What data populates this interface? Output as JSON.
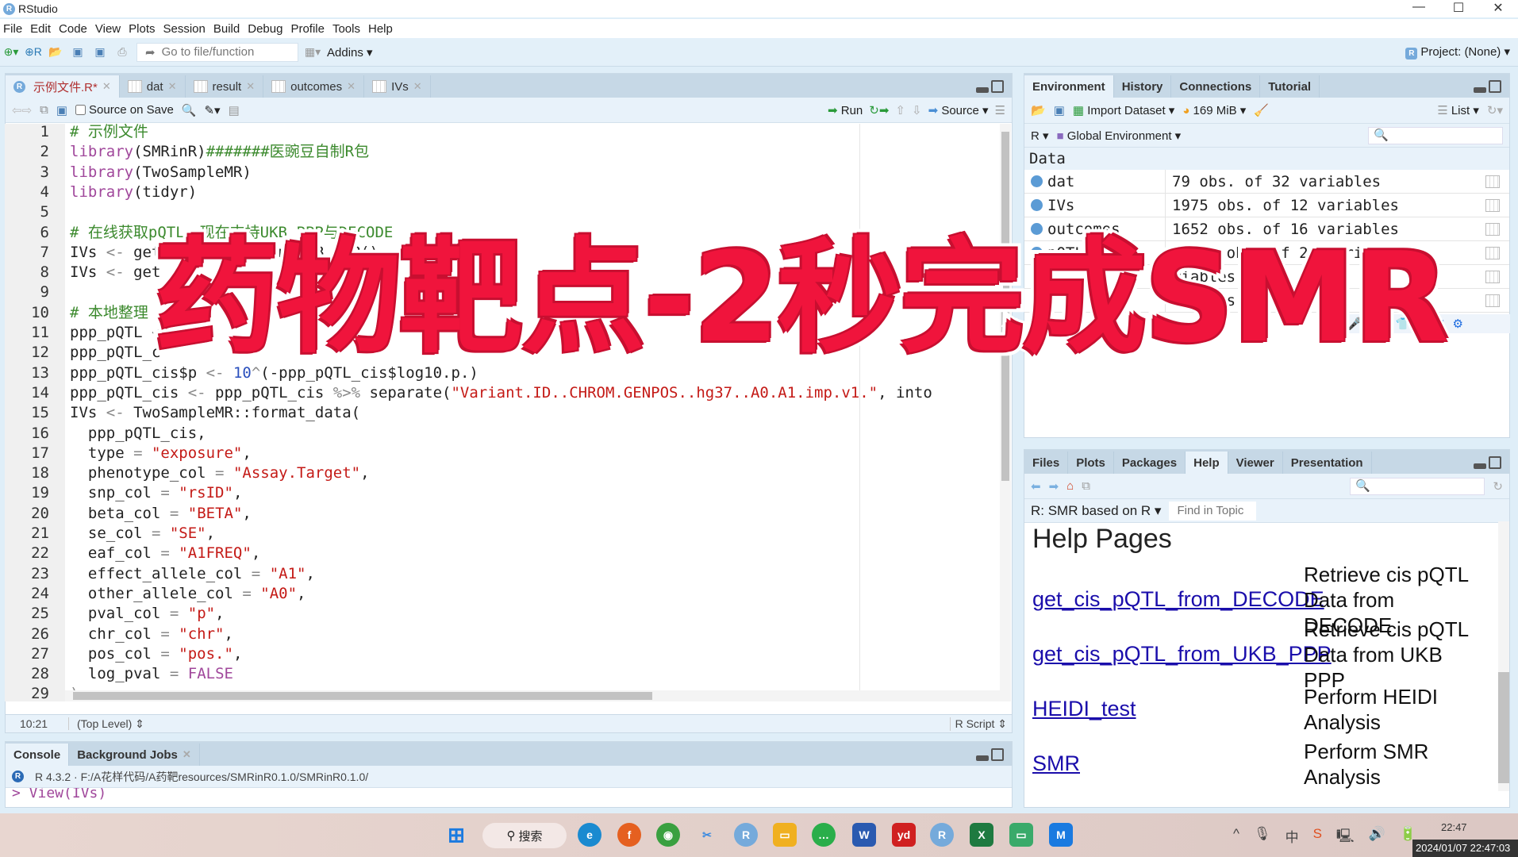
{
  "window": {
    "title": "RStudio"
  },
  "menu": [
    "File",
    "Edit",
    "Code",
    "View",
    "Plots",
    "Session",
    "Build",
    "Debug",
    "Profile",
    "Tools",
    "Help"
  ],
  "toolbar": {
    "goto_placeholder": "Go to file/function",
    "addins": "Addins",
    "project": "Project: (None)"
  },
  "editor": {
    "tabs": [
      {
        "label": "示例文件.R*",
        "active": true
      },
      {
        "label": "dat"
      },
      {
        "label": "result"
      },
      {
        "label": "outcomes"
      },
      {
        "label": "IVs"
      }
    ],
    "source_on_save": "Source on Save",
    "run": "Run",
    "source": "Source",
    "lines": [
      [
        [
          "# 示例文件",
          "c"
        ]
      ],
      [
        [
          "library",
          "k"
        ],
        [
          "(SMRinR)",
          ""
        ],
        [
          "#######医豌豆自制R包",
          "c"
        ]
      ],
      [
        [
          "library",
          "k"
        ],
        [
          "(TwoSampleMR)",
          ""
        ]
      ],
      [
        [
          "library",
          "k"
        ],
        [
          "(tidyr)",
          ""
        ]
      ],
      [],
      [
        [
          "# 在线获取pQTL，现在支持UKB_PPP与DECODE",
          "c"
        ]
      ],
      [
        [
          "IVs ",
          ""
        ],
        [
          "<-",
          "o"
        ],
        [
          " get_cis_pQTL_from_UKB_PPP()",
          ""
        ]
      ],
      [
        [
          "IVs ",
          ""
        ],
        [
          "<-",
          "o"
        ],
        [
          " get",
          ""
        ]
      ],
      [],
      [
        [
          "# 本地整理",
          "c"
        ]
      ],
      [
        [
          "ppp_pQTL ",
          ""
        ],
        [
          "<",
          "o"
        ]
      ],
      [
        [
          "ppp_pQTL_c",
          ""
        ]
      ],
      [
        [
          "ppp_pQTL_cis$p ",
          ""
        ],
        [
          "<-",
          "o"
        ],
        [
          " ",
          ""
        ],
        [
          "10",
          "n"
        ],
        [
          "^",
          "o"
        ],
        [
          "(-ppp_pQTL_cis$log10.p.)",
          ""
        ]
      ],
      [
        [
          "ppp_pQTL_cis ",
          ""
        ],
        [
          "<-",
          "o"
        ],
        [
          " ppp_pQTL_cis ",
          ""
        ],
        [
          "%>%",
          "o"
        ],
        [
          " separate(",
          ""
        ],
        [
          "\"Variant.ID..CHROM.GENPOS..hg37..A0.A1.imp.v1.\"",
          "s"
        ],
        [
          ", into",
          ""
        ]
      ],
      [
        [
          "IVs ",
          ""
        ],
        [
          "<-",
          "o"
        ],
        [
          " TwoSampleMR::format_data(",
          ""
        ]
      ],
      [
        [
          "  ppp_pQTL_cis,",
          ""
        ]
      ],
      [
        [
          "  type ",
          ""
        ],
        [
          "=",
          "o"
        ],
        [
          " ",
          ""
        ],
        [
          "\"exposure\"",
          "s"
        ],
        [
          ",",
          ""
        ]
      ],
      [
        [
          "  phenotype_col ",
          ""
        ],
        [
          "=",
          "o"
        ],
        [
          " ",
          ""
        ],
        [
          "\"Assay.Target\"",
          "s"
        ],
        [
          ",",
          ""
        ]
      ],
      [
        [
          "  snp_col ",
          ""
        ],
        [
          "=",
          "o"
        ],
        [
          " ",
          ""
        ],
        [
          "\"rsID\"",
          "s"
        ],
        [
          ",",
          ""
        ]
      ],
      [
        [
          "  beta_col ",
          ""
        ],
        [
          "=",
          "o"
        ],
        [
          " ",
          ""
        ],
        [
          "\"BETA\"",
          "s"
        ],
        [
          ",",
          ""
        ]
      ],
      [
        [
          "  se_col ",
          ""
        ],
        [
          "=",
          "o"
        ],
        [
          " ",
          ""
        ],
        [
          "\"SE\"",
          "s"
        ],
        [
          ",",
          ""
        ]
      ],
      [
        [
          "  eaf_col ",
          ""
        ],
        [
          "=",
          "o"
        ],
        [
          " ",
          ""
        ],
        [
          "\"A1FREQ\"",
          "s"
        ],
        [
          ",",
          ""
        ]
      ],
      [
        [
          "  effect_allele_col ",
          ""
        ],
        [
          "=",
          "o"
        ],
        [
          " ",
          ""
        ],
        [
          "\"A1\"",
          "s"
        ],
        [
          ",",
          ""
        ]
      ],
      [
        [
          "  other_allele_col ",
          ""
        ],
        [
          "=",
          "o"
        ],
        [
          " ",
          ""
        ],
        [
          "\"A0\"",
          "s"
        ],
        [
          ",",
          ""
        ]
      ],
      [
        [
          "  pval_col ",
          ""
        ],
        [
          "=",
          "o"
        ],
        [
          " ",
          ""
        ],
        [
          "\"p\"",
          "s"
        ],
        [
          ",",
          ""
        ]
      ],
      [
        [
          "  chr_col ",
          ""
        ],
        [
          "=",
          "o"
        ],
        [
          " ",
          ""
        ],
        [
          "\"chr\"",
          "s"
        ],
        [
          ",",
          ""
        ]
      ],
      [
        [
          "  pos_col ",
          ""
        ],
        [
          "=",
          "o"
        ],
        [
          " ",
          ""
        ],
        [
          "\"pos.\"",
          "s"
        ],
        [
          ",",
          ""
        ]
      ],
      [
        [
          "  log_pval ",
          ""
        ],
        [
          "=",
          "o"
        ],
        [
          " ",
          ""
        ],
        [
          "FALSE",
          "b"
        ]
      ],
      [
        [
          ")",
          "o"
        ]
      ],
      []
    ],
    "status": {
      "cursor": "10:21",
      "scope": "(Top Level)",
      "filetype": "R Script"
    }
  },
  "overlay_title": "药物靶点-2秒完成SMR",
  "console": {
    "tabs": [
      "Console",
      "Background Jobs"
    ],
    "path": "R 4.3.2 · F:/A花样代码/A药靶resources/SMRinR0.1.0/SMRinR0.1.0/",
    "last_line": "> View(IVs)"
  },
  "environment": {
    "tabs": [
      "Environment",
      "History",
      "Connections",
      "Tutorial"
    ],
    "import": "Import Dataset",
    "memory": "169 MiB",
    "view": "List",
    "lang": "R",
    "scope": "Global Environment",
    "section": "Data",
    "rows": [
      {
        "name": "dat",
        "value": "79 obs. of 32 variables"
      },
      {
        "name": "IVs",
        "value": "1975 obs. of 12 variables"
      },
      {
        "name": "outcomes",
        "value": "1652 obs. of 16 variables"
      },
      {
        "name": "pQTL",
        "value": "23588 obs. of 29 variables"
      },
      {
        "name": "",
        "value": "riables"
      },
      {
        "name": "",
        "value": "riables"
      }
    ]
  },
  "help": {
    "tabs": [
      "Files",
      "Plots",
      "Packages",
      "Help",
      "Viewer",
      "Presentation"
    ],
    "topic": "R: SMR based on R",
    "find_placeholder": "Find in Topic",
    "heading": "Help Pages",
    "entries": [
      {
        "link": "get_cis_pQTL_from_DECODE",
        "desc": "Retrieve cis pQTL Data from DECODE"
      },
      {
        "link": "get_cis_pQTL_from_UKB_PPP",
        "desc": "Retrieve cis pQTL Data from UKB PPP"
      },
      {
        "link": "HEIDI_test",
        "desc": "Perform HEIDI Analysis"
      },
      {
        "link": "SMR",
        "desc": "Perform SMR Analysis"
      }
    ]
  },
  "taskbar": {
    "search": "搜索",
    "time": "22:47",
    "timestamp": "2024/01/07 22:47:03"
  },
  "colors": {
    "accent": "#75aadb",
    "overlay": "#f0143c",
    "link": "#1a0dab"
  }
}
